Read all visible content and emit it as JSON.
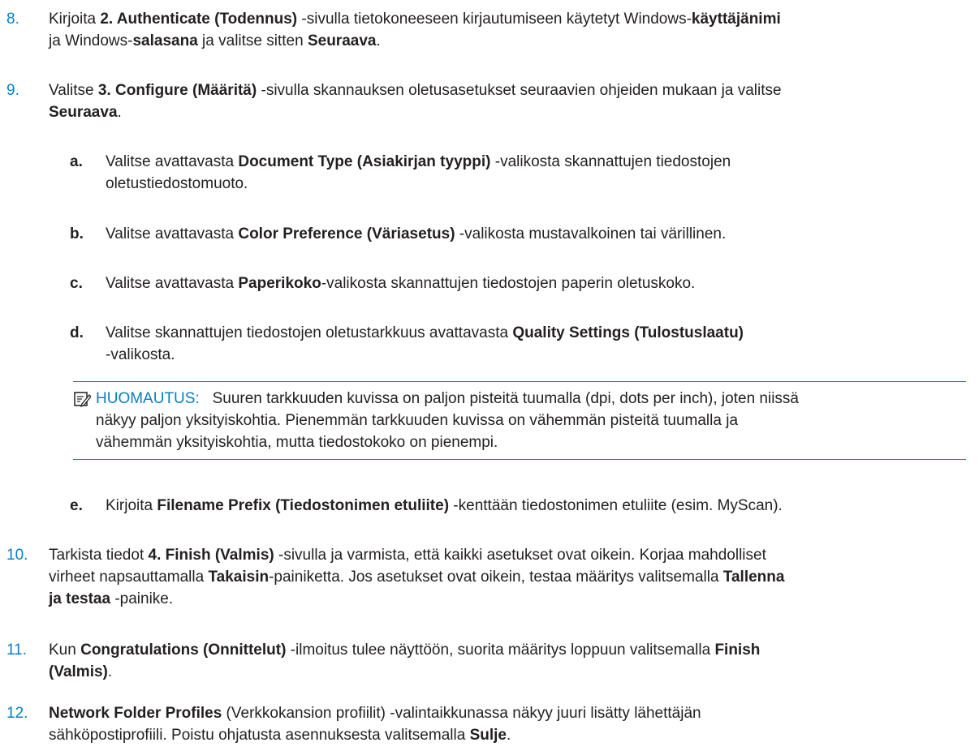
{
  "steps": {
    "s8": {
      "num": "8.",
      "t1": "Kirjoita ",
      "b1": "2. Authenticate (Todennus)",
      "t2": " -sivulla tietokoneeseen kirjautumiseen käytetyt Windows-",
      "b2": "käyttäjänimi",
      "t3": "ja Windows-",
      "b3": "salasana",
      "t4": " ja valitse sitten ",
      "b4": "Seuraava",
      "t5": "."
    },
    "s9": {
      "num": "9.",
      "t1": "Valitse ",
      "b1": "3. Configure (Määritä)",
      "t2": " -sivulla skannauksen oletusasetukset seuraavien ohjeiden mukaan ja valitse",
      "b2": "Seuraava",
      "t3": "."
    },
    "s9a": {
      "letter": "a.",
      "t1": "Valitse avattavasta ",
      "b1": "Document Type (Asiakirjan tyyppi)",
      "t2": " -valikosta skannattujen tiedostojen",
      "t3": "oletustiedostomuoto."
    },
    "s9b": {
      "letter": "b.",
      "t1": "Valitse avattavasta ",
      "b1": "Color Preference (Väriasetus)",
      "t2": " -valikosta mustavalkoinen tai värillinen."
    },
    "s9c": {
      "letter": "c.",
      "t1": "Valitse avattavasta ",
      "b1": "Paperikoko",
      "t2": "-valikosta skannattujen tiedostojen paperin oletuskoko."
    },
    "s9d": {
      "letter": "d.",
      "t1": "Valitse skannattujen tiedostojen oletustarkkuus avattavasta ",
      "b1": "Quality Settings (Tulostuslaatu)",
      "t2": "-valikosta."
    },
    "note": {
      "label": "HUOMAUTUS:",
      "l1": "Suuren tarkkuuden kuvissa on paljon pisteitä tuumalla (dpi, dots per inch), joten niissä",
      "l2": "näkyy paljon yksityiskohtia. Pienemmän tarkkuuden kuvissa on vähemmän pisteitä tuumalla ja",
      "l3": "vähemmän yksityiskohtia, mutta tiedostokoko on pienempi."
    },
    "s9e": {
      "letter": "e.",
      "t1": "Kirjoita ",
      "b1": "Filename Prefix (Tiedostonimen etuliite)",
      "t2": " -kenttään tiedostonimen etuliite (esim. MyScan)."
    },
    "s10": {
      "num": "10.",
      "t1": "Tarkista tiedot ",
      "b1": "4. Finish (Valmis)",
      "t2": " -sivulla ja varmista, että kaikki asetukset ovat oikein. Korjaa mahdolliset",
      "t3": "virheet napsauttamalla ",
      "b2": "Takaisin",
      "t4": "-painiketta. Jos asetukset ovat oikein, testaa määritys valitsemalla ",
      "b3": "Tallenna",
      "b4": "ja testaa",
      "t5": " -painike."
    },
    "s11": {
      "num": "11.",
      "t1": "Kun ",
      "b1": "Congratulations (Onnittelut)",
      "t2": " -ilmoitus tulee näyttöön, suorita määritys loppuun valitsemalla ",
      "b2": "Finish",
      "b3": "(Valmis)",
      "t3": "."
    },
    "s12": {
      "num": "12.",
      "b1": "Network Folder Profiles",
      "t1": " (Verkkokansion profiilit) -valintaikkunassa näkyy juuri lisätty lähettäjän",
      "t2": "sähköpostiprofiili. Poistu ohjatusta asennuksesta valitsemalla ",
      "b2": "Sulje",
      "t3": "."
    }
  },
  "colors": {
    "accent": "#0a7fc1",
    "text": "#231f20"
  },
  "icons": {
    "note": "note-pencil-icon"
  }
}
